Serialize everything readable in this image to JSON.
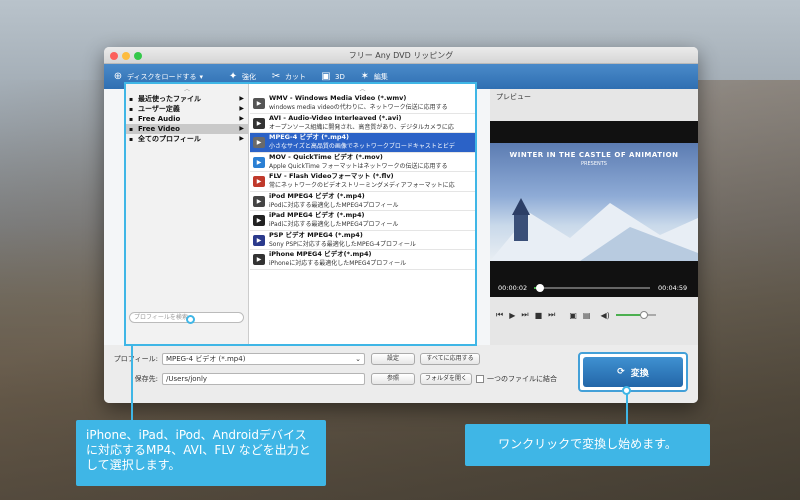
{
  "window": {
    "title": "フリー Any DVD リッピング"
  },
  "toolbar": {
    "load_disc": "ディスクをロードする",
    "enhance": "強化",
    "cut": "カット",
    "three_d": "3D",
    "edit": "編集"
  },
  "menu": {
    "categories": [
      {
        "label": "最近使ったファイル",
        "selected": false
      },
      {
        "label": "ユーザー定義",
        "selected": false
      },
      {
        "label": "Free Audio",
        "selected": false
      },
      {
        "label": "Free Video",
        "selected": true
      },
      {
        "label": "全てのプロフィール",
        "selected": false
      }
    ],
    "search_placeholder": "プロフィールを検索",
    "formats": [
      {
        "title": "WMV - Windows Media Video (*.wmv)",
        "desc": "windows media videoの代わりに、ネットワーク伝送に応用する",
        "icon": "wmv-icon",
        "color": "#555555",
        "selected": false
      },
      {
        "title": "AVI - Audio-Video Interleaved (*.avi)",
        "desc": "オープンソース組織に開発され、高音質があり、デジタルカメラに応",
        "icon": "avi-icon",
        "color": "#333333",
        "selected": false
      },
      {
        "title": "MPEG-4 ビデオ (*.mp4)",
        "desc": "小さなサイズと高品質の画像でネットワークブロードキャストとビデ",
        "icon": "mp4-icon",
        "color": "#6a6a6a",
        "selected": true
      },
      {
        "title": "MOV - QuickTime ビデオ (*.mov)",
        "desc": "Apple QuickTime フォーマットはネットワークの伝送に応用する",
        "icon": "quicktime-icon",
        "color": "#2a7fd4",
        "selected": false
      },
      {
        "title": "FLV - Flash Videoフォーマット (*.flv)",
        "desc": "常にネットワークのビデオストリーミングメディアフォーマットに応",
        "icon": "flash-icon",
        "color": "#c0392b",
        "selected": false
      },
      {
        "title": "iPod MPEG4 ビデオ (*.mp4)",
        "desc": "iPodに対応する最適化したMPEG4プロフィール",
        "icon": "ipod-icon",
        "color": "#444444",
        "selected": false
      },
      {
        "title": "iPad MPEG4 ビデオ (*.mp4)",
        "desc": "iPadに対応する最適化したMPEG4プロフィール",
        "icon": "ipad-icon",
        "color": "#222222",
        "selected": false
      },
      {
        "title": "PSP ビデオ MPEG4 (*.mp4)",
        "desc": "Sony PSPに対応する最適化したMPEG-4プロフィール",
        "icon": "psp-icon",
        "color": "#2b3a8c",
        "selected": false
      },
      {
        "title": "iPhone MPEG4 ビデオ(*.mp4)",
        "desc": "iPhoneに対応する最適化したMPEG4プロフィール",
        "icon": "iphone-icon",
        "color": "#333333",
        "selected": false
      }
    ]
  },
  "preview": {
    "label": "プレビュー",
    "video_title": "WINTER IN THE CASTLE OF ANIMATION",
    "video_subtitle": "PRESENTS",
    "time_current": "00:00:02",
    "time_total": "00:04:59",
    "progress": 0.05,
    "volume": 0.7
  },
  "bottom": {
    "profile_label": "プロフィール:",
    "profile_value": "MPEG-4 ビデオ (*.mp4)",
    "settings_button": "設定",
    "apply_all_button": "すべてに応用する",
    "save_label": "保存先:",
    "save_path": "/Users/jonly",
    "browse_button": "参照",
    "open_folder_button": "フォルダを開く",
    "merge_label": "一つのファイルに結合",
    "convert_button": "変換"
  },
  "callouts": {
    "left": "iPhone、iPad、iPod、Androidデバイスに対応するMP4、AVI、FLV などを出力として選択します。",
    "right": "ワンクリックで変換し始めます。"
  },
  "colors": {
    "accent": "#3fb6e6",
    "toolbar": "#2f6fb2",
    "selection": "#2b62c7"
  }
}
